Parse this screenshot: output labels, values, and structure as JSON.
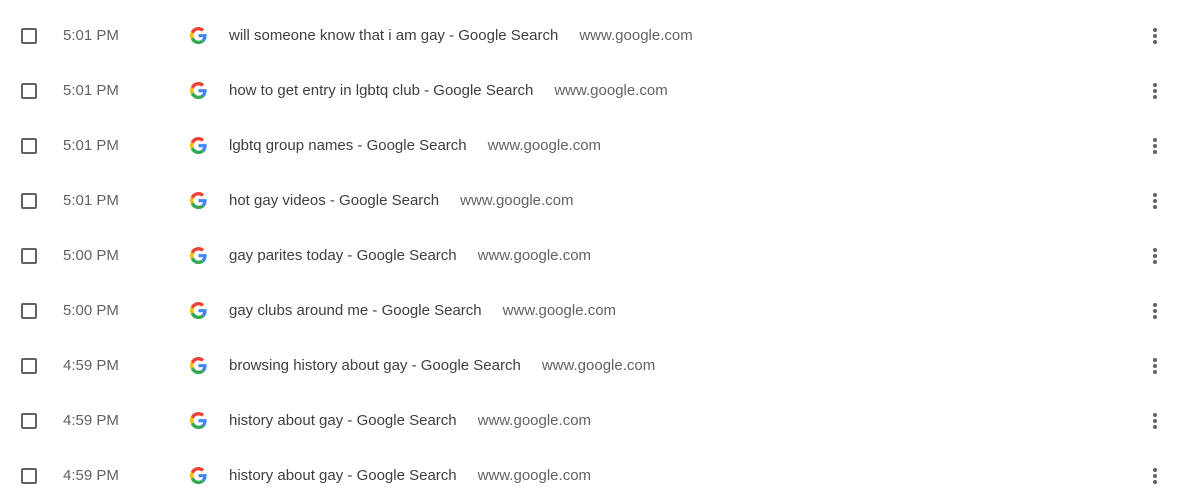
{
  "colors": {
    "text_primary": "#3c4043",
    "text_secondary": "#5f6368",
    "google_blue": "#4285F4",
    "google_red": "#EA4335",
    "google_yellow": "#FBBC05",
    "google_green": "#34A853"
  },
  "history": {
    "items": [
      {
        "time": "5:01 PM",
        "title": "will someone know that i am gay - Google Search",
        "domain": "www.google.com",
        "icon": "google-favicon-icon",
        "checked": false
      },
      {
        "time": "5:01 PM",
        "title": "how to get entry in lgbtq club - Google Search",
        "domain": "www.google.com",
        "icon": "google-favicon-icon",
        "checked": false
      },
      {
        "time": "5:01 PM",
        "title": "lgbtq group names - Google Search",
        "domain": "www.google.com",
        "icon": "google-favicon-icon",
        "checked": false
      },
      {
        "time": "5:01 PM",
        "title": "hot gay videos - Google Search",
        "domain": "www.google.com",
        "icon": "google-favicon-icon",
        "checked": false
      },
      {
        "time": "5:00 PM",
        "title": "gay parites today - Google Search",
        "domain": "www.google.com",
        "icon": "google-favicon-icon",
        "checked": false
      },
      {
        "time": "5:00 PM",
        "title": "gay clubs around me - Google Search",
        "domain": "www.google.com",
        "icon": "google-favicon-icon",
        "checked": false
      },
      {
        "time": "4:59 PM",
        "title": "browsing history about gay - Google Search",
        "domain": "www.google.com",
        "icon": "google-favicon-icon",
        "checked": false
      },
      {
        "time": "4:59 PM",
        "title": "history about gay - Google Search",
        "domain": "www.google.com",
        "icon": "google-favicon-icon",
        "checked": false
      },
      {
        "time": "4:59 PM",
        "title": "history about gay - Google Search",
        "domain": "www.google.com",
        "icon": "google-favicon-icon",
        "checked": false
      }
    ]
  }
}
